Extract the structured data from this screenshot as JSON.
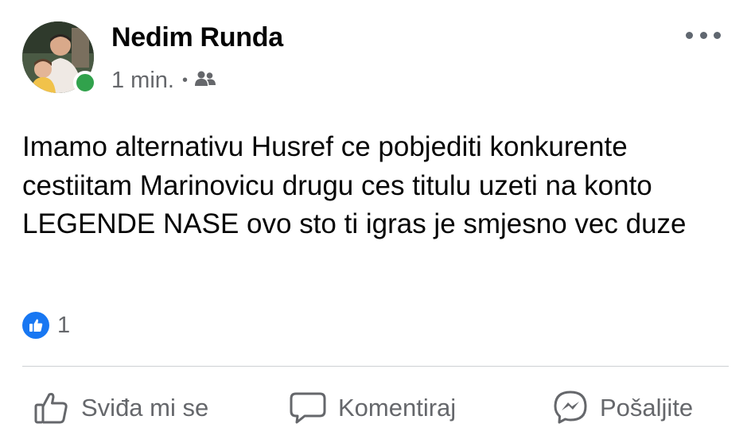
{
  "post": {
    "author": "Nedim Runda",
    "time": "1 min.",
    "separator": "•",
    "audience_icon": "friends-icon",
    "body": "Imamo alternativu Husref ce pobjediti konkurente cestiitam Marinovicu drugu ces titulu uzeti na konto LEGENDE NASE ovo sto ti igras je smjesno vec duze",
    "reaction_count": "1"
  },
  "actions": {
    "like": "Sviđa mi se",
    "comment": "Komentiraj",
    "share": "Pošaljite"
  },
  "colors": {
    "online": "#31a24c",
    "like_blue": "#1877f2",
    "secondary_text": "#65676b"
  }
}
